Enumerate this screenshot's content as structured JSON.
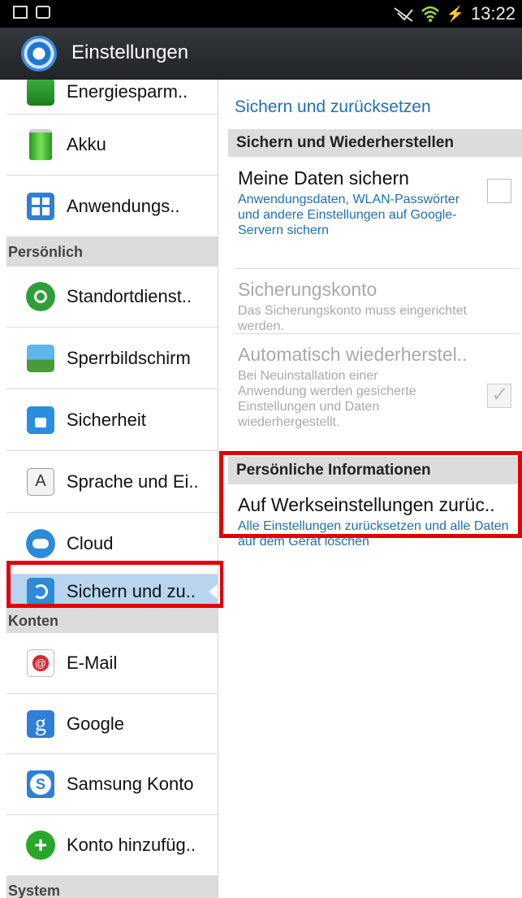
{
  "statusbar": {
    "time": "13:22",
    "battery_glyph": "⚡"
  },
  "actionbar": {
    "title": "Einstellungen"
  },
  "left": {
    "rows": [
      {
        "label": "Energiesparm..",
        "icon": "energy-icon"
      },
      {
        "label": "Akku",
        "icon": "battery-icon"
      },
      {
        "label": "Anwendungs..",
        "icon": "apps-icon"
      },
      {
        "header": "Persönlich"
      },
      {
        "label": "Standortdienst..",
        "icon": "location-icon"
      },
      {
        "label": "Sperrbildschirm",
        "icon": "lockscreen-icon"
      },
      {
        "label": "Sicherheit",
        "icon": "lock-icon"
      },
      {
        "label": "Sprache und Ei..",
        "icon": "language-icon"
      },
      {
        "label": "Cloud",
        "icon": "cloud-icon"
      },
      {
        "label": "Sichern und zu..",
        "icon": "backup-icon",
        "active": true
      },
      {
        "header": "Konten"
      },
      {
        "label": "E-Mail",
        "icon": "email-icon"
      },
      {
        "label": "Google",
        "icon": "google-icon"
      },
      {
        "label": "Samsung Konto",
        "icon": "samsung-icon"
      },
      {
        "label": "Konto hinzufüg..",
        "icon": "add-account-icon"
      },
      {
        "header": "System"
      }
    ],
    "language_glyph": "A",
    "google_glyph": "g",
    "samsung_glyph": "S",
    "add_glyph": "+",
    "email_glyph": "@"
  },
  "right": {
    "section_title": "Sichern und zurücksetzen",
    "header1": "Sichern und Wiederherstellen",
    "items": [
      {
        "title": "Meine Daten sichern",
        "subtitle": "Anwendungsdaten, WLAN-Passwörter und andere Einstellungen auf Google-Servern sichern",
        "checked": false,
        "enabled": true
      },
      {
        "title": "Sicherungskonto",
        "subtitle": "Das Sicherungskonto muss eingerichtet werden.",
        "enabled": false
      },
      {
        "title": "Automatisch wiederherstel..",
        "subtitle": "Bei Neuinstallation einer Anwendung werden gesicherte Einstellungen und Daten wiederhergestellt.",
        "checked": true,
        "enabled": false
      }
    ],
    "header2": "Persönliche Informationen",
    "reset": {
      "title": "Auf Werkseinstellungen zurüc..",
      "subtitle": "Alle Einstellungen zurücksetzen und alle Daten auf dem Gerät löschen"
    }
  },
  "colors": {
    "accent": "#1e6fb5",
    "highlight": "#e30000",
    "selected": "#b8d4ee"
  }
}
